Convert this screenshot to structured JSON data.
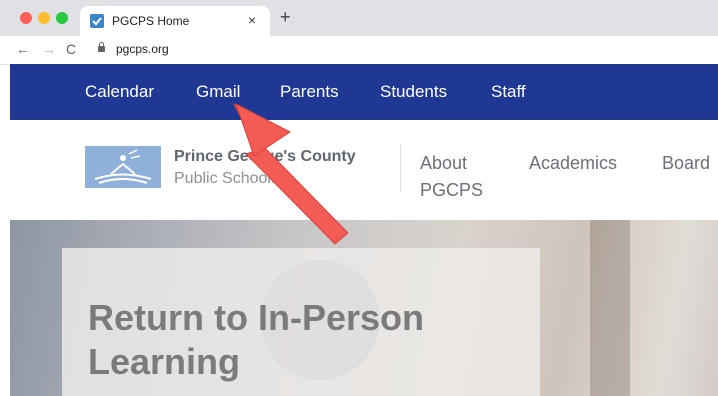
{
  "browser": {
    "tab_title": "PGCPS Home",
    "tab_close": "×",
    "new_tab": "+",
    "back": "←",
    "forward": "→",
    "reload": "C",
    "url": "pgcps.org"
  },
  "utility_nav": {
    "items": [
      {
        "label": "Calendar"
      },
      {
        "label": "Gmail"
      },
      {
        "label": "Parents"
      },
      {
        "label": "Students"
      },
      {
        "label": "Staff"
      }
    ]
  },
  "header": {
    "school_line1": "Prince George's County",
    "school_line2": "Public Schools",
    "nav": [
      {
        "label": "About\nPGCPS"
      },
      {
        "label": "Academics"
      },
      {
        "label": "Board"
      }
    ]
  },
  "hero": {
    "title": "Return to In-Person Learning"
  },
  "colors": {
    "utility_bar": "#1f3894",
    "annotation_arrow": "#f25c54",
    "logo_bg": "#8eb0d9"
  },
  "icons": {
    "lock": "lock-icon",
    "favicon": "pgcps-favicon-icon",
    "arrow": "annotation-arrow-icon"
  }
}
